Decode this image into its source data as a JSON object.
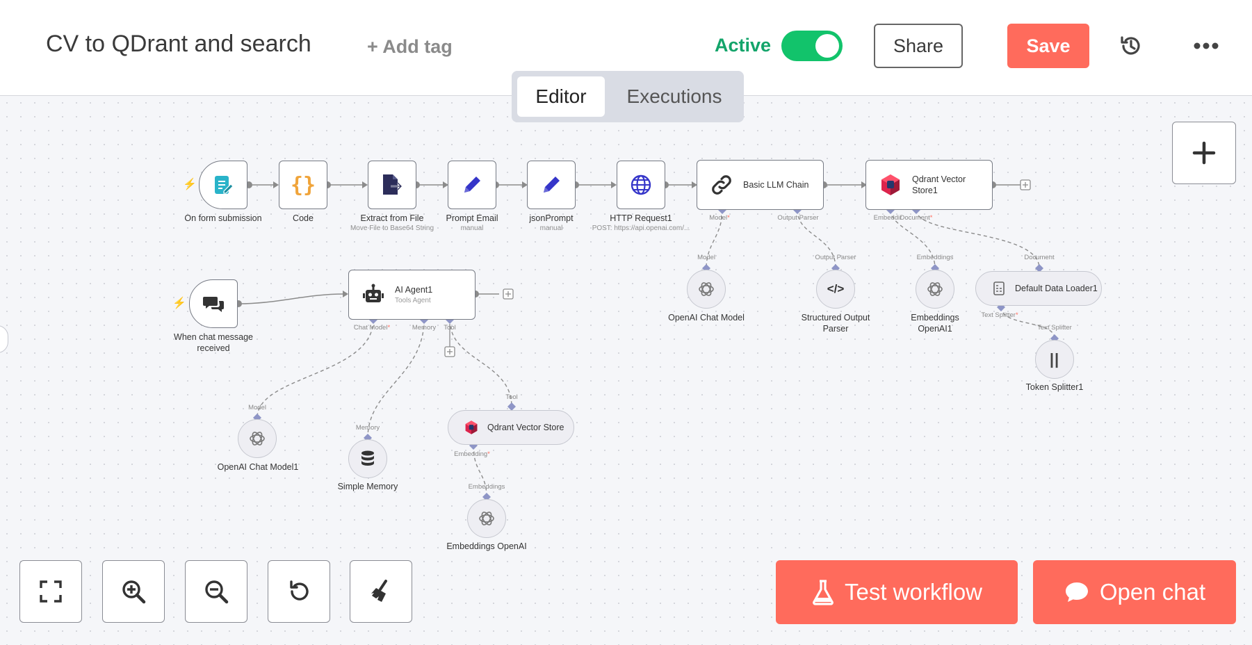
{
  "header": {
    "title": "CV to QDrant and search",
    "add_tag": "+ Add tag",
    "active_label": "Active",
    "active": true,
    "share_label": "Share",
    "save_label": "Save"
  },
  "tabs": [
    {
      "label": "Editor",
      "selected": true
    },
    {
      "label": "Executions",
      "selected": false
    }
  ],
  "nodes": {
    "form": {
      "label": "On form submission"
    },
    "code": {
      "label": "Code"
    },
    "extract": {
      "label": "Extract from File",
      "sub": "Move File to Base64 String"
    },
    "prompt_email": {
      "label": "Prompt Email",
      "sub": "manual"
    },
    "json_prompt": {
      "label": "jsonPrompt",
      "sub": "manual"
    },
    "http": {
      "label": "HTTP Request1",
      "sub": "POST: https://api.openai.com/..."
    },
    "llm_chain": {
      "label": "Basic LLM Chain"
    },
    "qdrant1": {
      "label_line1": "Qdrant Vector",
      "label_line2": "Store1"
    },
    "chat_trigger": {
      "label_line1": "When chat message",
      "label_line2": "received"
    },
    "agent": {
      "label": "AI Agent1",
      "sub": "Tools Agent"
    },
    "openai_chat": {
      "label": "OpenAI Chat Model"
    },
    "struct_parser": {
      "label_line1": "Structured Output",
      "label_line2": "Parser"
    },
    "emb_openai1": {
      "label_line1": "Embeddings",
      "label_line2": "OpenAI1"
    },
    "data_loader": {
      "label": "Default Data Loader1"
    },
    "token_splitter": {
      "label": "Token Splitter1"
    },
    "openai_chat1": {
      "label": "OpenAI Chat Model1"
    },
    "simple_memory": {
      "label": "Simple Memory"
    },
    "qdrant": {
      "label": "Qdrant Vector Store"
    },
    "emb_openai": {
      "label": "Embeddings OpenAI"
    }
  },
  "ports": {
    "llm_model": "Model",
    "llm_parser": "Output Parser",
    "q1_embed": "Embeddir",
    "q1_doc": "Document",
    "openai_model": "Model",
    "parser_in": "Output Parser",
    "emb1_in": "Embeddings",
    "loader_in": "Document",
    "loader_split": "Text Splitter",
    "splitter_in": "Text Splitter",
    "agent_chat": "Chat Model",
    "agent_mem": "Memory",
    "agent_tool": "Tool",
    "m1_in": "Model",
    "mem_in": "Memory",
    "tool_in": "Tool",
    "qd_emb": "Embedding",
    "emb_in": "Embeddings",
    "required_mark": "*"
  },
  "buttons": {
    "test_workflow": "Test workflow",
    "open_chat": "Open chat"
  },
  "colors": {
    "brand": "#ff6b5c",
    "active": "#13a46a",
    "toggle": "#12c36b",
    "port": "#8e95c6"
  },
  "icons": {
    "history": "history-icon",
    "more": "more-icon",
    "fit": "fit-view-icon",
    "zoom_in": "zoom-in-icon",
    "zoom_out": "zoom-out-icon",
    "reset": "reset-zoom-icon",
    "tidy": "broom-icon",
    "add_node": "plus-icon"
  }
}
